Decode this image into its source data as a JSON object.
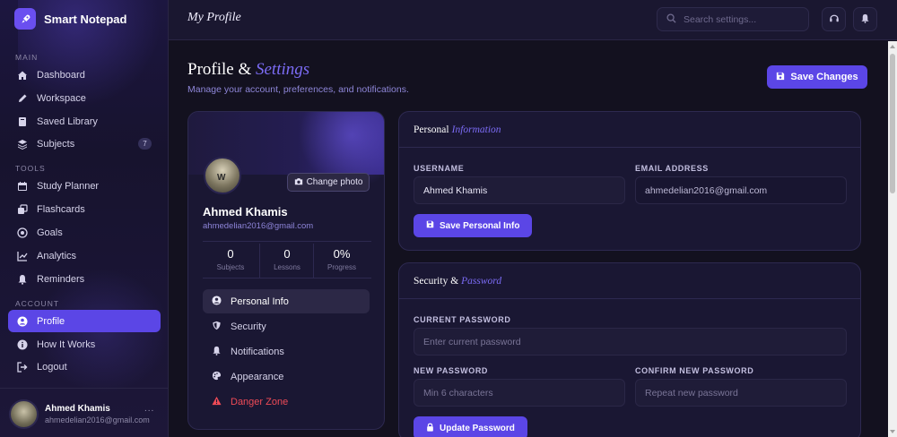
{
  "app": {
    "name": "Smart Notepad"
  },
  "sidebar": {
    "sections": {
      "main": "MAIN",
      "tools": "TOOLS",
      "account": "ACCOUNT"
    },
    "items": [
      {
        "label": "Dashboard",
        "icon": "home-icon"
      },
      {
        "label": "Workspace",
        "icon": "pencil-icon"
      },
      {
        "label": "Saved Library",
        "icon": "book-icon"
      },
      {
        "label": "Subjects",
        "icon": "layers-icon",
        "badge": "7"
      },
      {
        "label": "Study Planner",
        "icon": "calendar-icon"
      },
      {
        "label": "Flashcards",
        "icon": "cards-icon"
      },
      {
        "label": "Goals",
        "icon": "target-icon"
      },
      {
        "label": "Analytics",
        "icon": "chart-icon"
      },
      {
        "label": "Reminders",
        "icon": "bell-icon"
      },
      {
        "label": "Profile",
        "icon": "user-circle-icon",
        "active": true
      },
      {
        "label": "How It Works",
        "icon": "info-icon"
      },
      {
        "label": "Logout",
        "icon": "logout-icon"
      }
    ],
    "user": {
      "name": "Ahmed Khamis",
      "email": "ahmedelian2016@gmail.com",
      "more": "..."
    }
  },
  "topbar": {
    "title": "My Profile",
    "search_placeholder": "Search settings..."
  },
  "page": {
    "title_plain": "Profile & ",
    "title_accent": "Settings",
    "subtitle": "Manage your account, preferences, and notifications.",
    "save_label": "Save Changes"
  },
  "profile_card": {
    "change_photo": "Change photo",
    "name": "Ahmed Khamis",
    "email": "ahmedelian2016@gmail.com",
    "stats": [
      {
        "value": "0",
        "label": "Subjects"
      },
      {
        "value": "0",
        "label": "Lessons"
      },
      {
        "value": "0%",
        "label": "Progress"
      }
    ],
    "menu": [
      {
        "label": "Personal Info",
        "icon": "user-circle-icon",
        "active": true
      },
      {
        "label": "Security",
        "icon": "shield-icon"
      },
      {
        "label": "Notifications",
        "icon": "bell-icon"
      },
      {
        "label": "Appearance",
        "icon": "palette-icon"
      },
      {
        "label": "Danger Zone",
        "icon": "warning-icon",
        "danger": true
      }
    ]
  },
  "personal": {
    "title_plain": "Personal ",
    "title_accent": "Information",
    "username_label": "USERNAME",
    "username_value": "Ahmed Khamis",
    "email_label": "EMAIL ADDRESS",
    "email_value": "ahmedelian2016@gmail.com",
    "save_label": "Save Personal Info"
  },
  "security": {
    "title_plain": "Security & ",
    "title_accent": "Password",
    "current_label": "CURRENT PASSWORD",
    "current_placeholder": "Enter current password",
    "new_label": "NEW PASSWORD",
    "new_placeholder": "Min 6 characters",
    "confirm_label": "CONFIRM NEW PASSWORD",
    "confirm_placeholder": "Repeat new password",
    "update_label": "Update Password"
  },
  "colors": {
    "accent": "#5b46e6",
    "accent_text": "#7c6cf6",
    "danger": "#ef4b57",
    "background": "#13111f"
  }
}
